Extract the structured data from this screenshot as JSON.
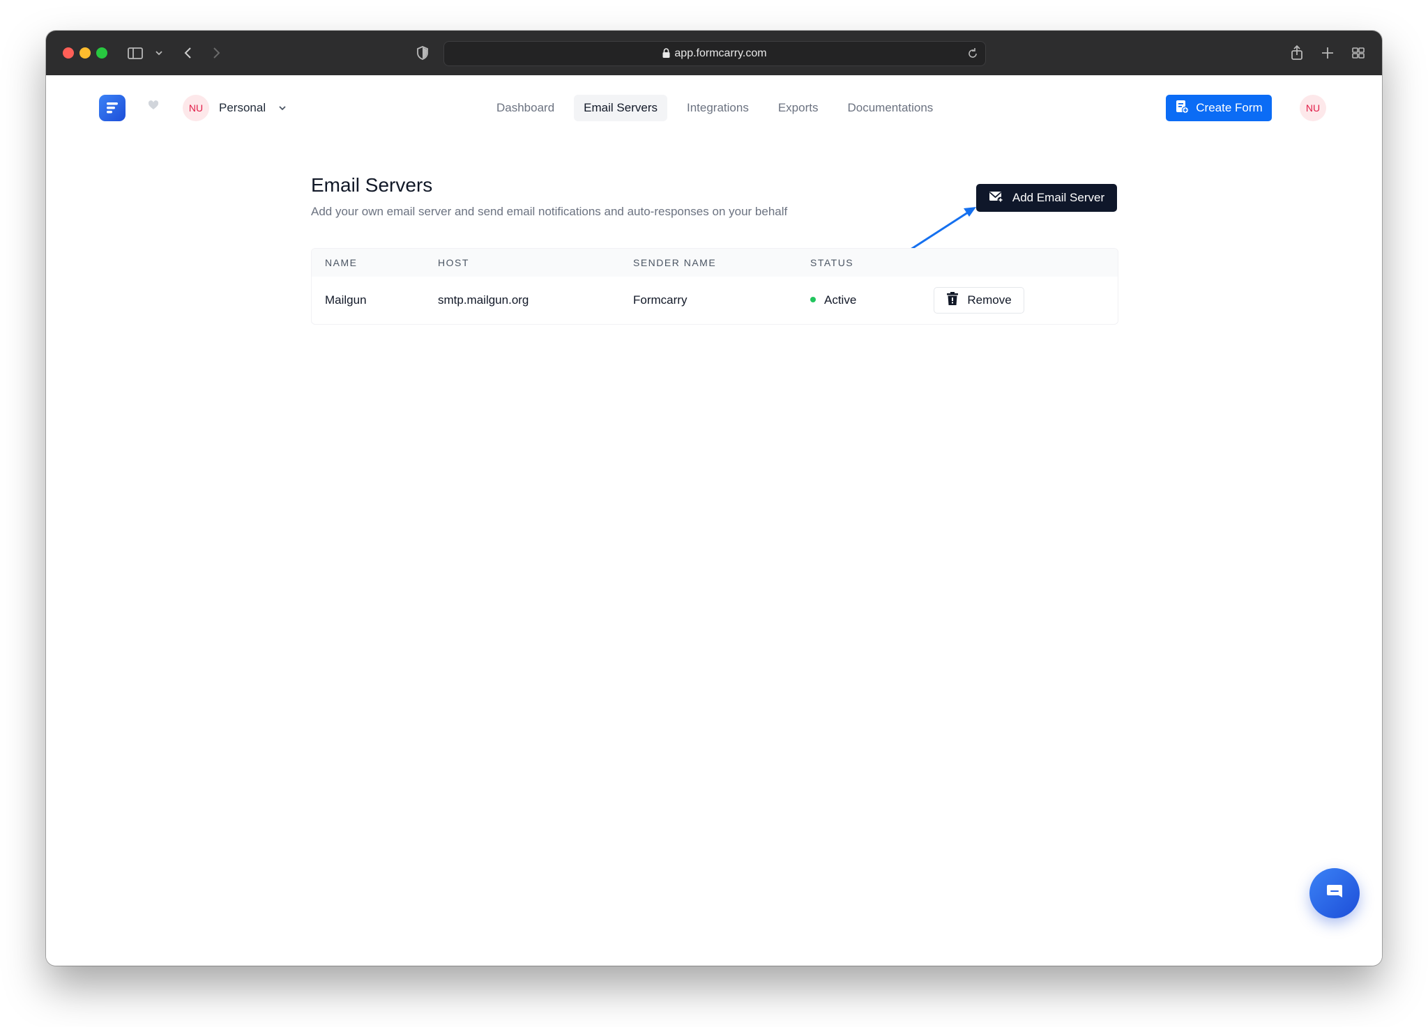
{
  "browser": {
    "url": "app.formcarry.com"
  },
  "header": {
    "workspace": {
      "avatar_initials": "NU",
      "name": "Personal"
    },
    "nav": [
      {
        "label": "Dashboard",
        "active": false
      },
      {
        "label": "Email Servers",
        "active": true
      },
      {
        "label": "Integrations",
        "active": false
      },
      {
        "label": "Exports",
        "active": false
      },
      {
        "label": "Documentations",
        "active": false
      }
    ],
    "create_form_label": "Create Form",
    "user_avatar_initials": "NU"
  },
  "page": {
    "title": "Email Servers",
    "subtitle": "Add your own email server and send email notifications and auto-responses on your behalf",
    "add_button_label": "Add Email Server"
  },
  "table": {
    "columns": [
      "NAME",
      "HOST",
      "SENDER NAME",
      "STATUS"
    ],
    "rows": [
      {
        "name": "Mailgun",
        "host": "smtp.mailgun.org",
        "sender_name": "Formcarry",
        "status": "Active",
        "action_label": "Remove"
      }
    ]
  },
  "colors": {
    "primary": "#0b6cf5",
    "dark_button": "#0f172a",
    "status_active": "#22c55e",
    "annotation_arrow": "#1570ef"
  }
}
